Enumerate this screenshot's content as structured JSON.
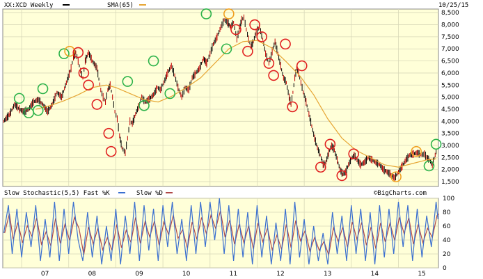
{
  "chart_data": [
    {
      "type": "line",
      "ticker_label": "XX:XCD Weekly",
      "sma_label": "SMA(65)",
      "date_label": "10/25/15",
      "watermark": "©BigCharts.com",
      "y_ticks": [
        "8,500",
        "8,000",
        "7,500",
        "7,000",
        "6,500",
        "6,000",
        "5,500",
        "5,000",
        "4,500",
        "4,000",
        "3,500",
        "3,000",
        "2,500",
        "2,000",
        "1,500"
      ],
      "y_tick_values": [
        8500,
        8000,
        7500,
        7000,
        6500,
        6000,
        5500,
        5000,
        4500,
        4000,
        3500,
        3000,
        2500,
        2000,
        1500
      ],
      "ylim": [
        1300,
        8650
      ],
      "x_tick_labels": [
        "07",
        "08",
        "09",
        "10",
        "11",
        "12",
        "13",
        "14",
        "15"
      ],
      "x_tick_values": [
        2007,
        2008,
        2009,
        2010,
        2011,
        2012,
        2013,
        2014,
        2015
      ],
      "xlim": [
        2006.6,
        2015.85
      ],
      "price_points": [
        [
          2006.62,
          4000
        ],
        [
          2006.75,
          4300
        ],
        [
          2006.85,
          4700
        ],
        [
          2006.95,
          4500
        ],
        [
          2007.05,
          4400
        ],
        [
          2007.15,
          4500
        ],
        [
          2007.25,
          4800
        ],
        [
          2007.35,
          4900
        ],
        [
          2007.45,
          4700
        ],
        [
          2007.55,
          4400
        ],
        [
          2007.65,
          4700
        ],
        [
          2007.75,
          5200
        ],
        [
          2007.85,
          5000
        ],
        [
          2007.95,
          5600
        ],
        [
          2008.05,
          6200
        ],
        [
          2008.1,
          6650
        ],
        [
          2008.15,
          6850
        ],
        [
          2008.2,
          6500
        ],
        [
          2008.25,
          6100
        ],
        [
          2008.3,
          5800
        ],
        [
          2008.35,
          6500
        ],
        [
          2008.42,
          6850
        ],
        [
          2008.5,
          6500
        ],
        [
          2008.6,
          6200
        ],
        [
          2008.68,
          5300
        ],
        [
          2008.73,
          5000
        ],
        [
          2008.78,
          4800
        ],
        [
          2008.83,
          5300
        ],
        [
          2008.88,
          5500
        ],
        [
          2008.93,
          5000
        ],
        [
          2008.98,
          4400
        ],
        [
          2009.03,
          4100
        ],
        [
          2009.08,
          3400
        ],
        [
          2009.13,
          2900
        ],
        [
          2009.2,
          2700
        ],
        [
          2009.25,
          3300
        ],
        [
          2009.3,
          4000
        ],
        [
          2009.35,
          3900
        ],
        [
          2009.42,
          4300
        ],
        [
          2009.48,
          4600
        ],
        [
          2009.55,
          5000
        ],
        [
          2009.62,
          4800
        ],
        [
          2009.7,
          4900
        ],
        [
          2009.8,
          5100
        ],
        [
          2009.88,
          5400
        ],
        [
          2009.95,
          5300
        ],
        [
          2010.02,
          5600
        ],
        [
          2010.1,
          6000
        ],
        [
          2010.18,
          6300
        ],
        [
          2010.25,
          5900
        ],
        [
          2010.32,
          5400
        ],
        [
          2010.4,
          5000
        ],
        [
          2010.47,
          5400
        ],
        [
          2010.55,
          5300
        ],
        [
          2010.62,
          5800
        ],
        [
          2010.7,
          6000
        ],
        [
          2010.78,
          6200
        ],
        [
          2010.86,
          6600
        ],
        [
          2010.93,
          6400
        ],
        [
          2011.0,
          6800
        ],
        [
          2011.07,
          7200
        ],
        [
          2011.15,
          7500
        ],
        [
          2011.23,
          7900
        ],
        [
          2011.3,
          8200
        ],
        [
          2011.37,
          8100
        ],
        [
          2011.44,
          7900
        ],
        [
          2011.5,
          8100
        ],
        [
          2011.57,
          7400
        ],
        [
          2011.62,
          7800
        ],
        [
          2011.67,
          8200
        ],
        [
          2011.72,
          8300
        ],
        [
          2011.77,
          7800
        ],
        [
          2011.82,
          7400
        ],
        [
          2011.87,
          7100
        ],
        [
          2011.92,
          7300
        ],
        [
          2011.98,
          7700
        ],
        [
          2012.05,
          7900
        ],
        [
          2012.12,
          7400
        ],
        [
          2012.18,
          6800
        ],
        [
          2012.25,
          6400
        ],
        [
          2012.32,
          6900
        ],
        [
          2012.38,
          7300
        ],
        [
          2012.44,
          6800
        ],
        [
          2012.5,
          6300
        ],
        [
          2012.56,
          5800
        ],
        [
          2012.62,
          5600
        ],
        [
          2012.68,
          5000
        ],
        [
          2012.72,
          4700
        ],
        [
          2012.76,
          5200
        ],
        [
          2012.8,
          5800
        ],
        [
          2012.84,
          6200
        ],
        [
          2012.88,
          6000
        ],
        [
          2012.93,
          5600
        ],
        [
          2012.98,
          5200
        ],
        [
          2013.04,
          4800
        ],
        [
          2013.1,
          4300
        ],
        [
          2013.16,
          3800
        ],
        [
          2013.22,
          3300
        ],
        [
          2013.28,
          2900
        ],
        [
          2013.34,
          2600
        ],
        [
          2013.4,
          2200
        ],
        [
          2013.46,
          2300
        ],
        [
          2013.52,
          2700
        ],
        [
          2013.58,
          3000
        ],
        [
          2013.64,
          2800
        ],
        [
          2013.7,
          2400
        ],
        [
          2013.76,
          2000
        ],
        [
          2013.82,
          1800
        ],
        [
          2013.88,
          1900
        ],
        [
          2013.94,
          2200
        ],
        [
          2014.0,
          2450
        ],
        [
          2014.06,
          2600
        ],
        [
          2014.12,
          2400
        ],
        [
          2014.2,
          2200
        ],
        [
          2014.28,
          2300
        ],
        [
          2014.36,
          2500
        ],
        [
          2014.44,
          2400
        ],
        [
          2014.52,
          2300
        ],
        [
          2014.6,
          2200
        ],
        [
          2014.68,
          2000
        ],
        [
          2014.76,
          1900
        ],
        [
          2014.84,
          1800
        ],
        [
          2014.92,
          1650
        ],
        [
          2015.0,
          1900
        ],
        [
          2015.08,
          2150
        ],
        [
          2015.16,
          2400
        ],
        [
          2015.24,
          2600
        ],
        [
          2015.32,
          2650
        ],
        [
          2015.4,
          2700
        ],
        [
          2015.48,
          2600
        ],
        [
          2015.55,
          2650
        ],
        [
          2015.6,
          2500
        ],
        [
          2015.66,
          2400
        ],
        [
          2015.72,
          2200
        ],
        [
          2015.78,
          2600
        ],
        [
          2015.82,
          2900
        ]
      ],
      "sma_points": [
        [
          2007.3,
          4500
        ],
        [
          2007.6,
          4650
        ],
        [
          2007.9,
          4850
        ],
        [
          2008.2,
          5100
        ],
        [
          2008.5,
          5400
        ],
        [
          2008.8,
          5500
        ],
        [
          2009.0,
          5400
        ],
        [
          2009.3,
          5150
        ],
        [
          2009.6,
          4900
        ],
        [
          2009.9,
          4800
        ],
        [
          2010.2,
          5050
        ],
        [
          2010.5,
          5400
        ],
        [
          2010.8,
          5800
        ],
        [
          2011.1,
          6400
        ],
        [
          2011.4,
          7000
        ],
        [
          2011.7,
          7300
        ],
        [
          2012.0,
          7350
        ],
        [
          2012.3,
          7050
        ],
        [
          2012.6,
          6500
        ],
        [
          2012.9,
          5900
        ],
        [
          2013.2,
          5100
        ],
        [
          2013.5,
          4100
        ],
        [
          2013.8,
          3300
        ],
        [
          2014.1,
          2800
        ],
        [
          2014.4,
          2500
        ],
        [
          2014.7,
          2200
        ],
        [
          2015.0,
          2100
        ],
        [
          2015.3,
          2250
        ],
        [
          2015.6,
          2400
        ],
        [
          2015.8,
          2450
        ]
      ],
      "sma_color": "#e6a533",
      "price_color": "#000000"
    },
    {
      "type": "line",
      "indicator_label": "Slow Stochastic(5,5) Fast %K",
      "slow_label": "Slow %D",
      "y_ticks": [
        "100",
        "80",
        "60",
        "40",
        "20",
        "0"
      ],
      "y_tick_values": [
        100,
        80,
        60,
        40,
        20,
        0
      ],
      "ylim": [
        0,
        100
      ],
      "fast_color": "#3a6fd0",
      "slow_color": "#b04848",
      "cycles": [
        [
          2006.62,
          50
        ],
        [
          2006.72,
          90
        ],
        [
          2006.8,
          20
        ],
        [
          2006.9,
          85
        ],
        [
          2007.0,
          15
        ],
        [
          2007.1,
          80
        ],
        [
          2007.2,
          30
        ],
        [
          2007.3,
          90
        ],
        [
          2007.4,
          10
        ],
        [
          2007.5,
          70
        ],
        [
          2007.6,
          15
        ],
        [
          2007.7,
          95
        ],
        [
          2007.8,
          10
        ],
        [
          2007.9,
          85
        ],
        [
          2008.0,
          20
        ],
        [
          2008.1,
          95
        ],
        [
          2008.2,
          40
        ],
        [
          2008.3,
          10
        ],
        [
          2008.4,
          80
        ],
        [
          2008.5,
          15
        ],
        [
          2008.6,
          75
        ],
        [
          2008.7,
          5
        ],
        [
          2008.8,
          60
        ],
        [
          2008.9,
          10
        ],
        [
          2009.0,
          85
        ],
        [
          2009.1,
          5
        ],
        [
          2009.2,
          75
        ],
        [
          2009.3,
          20
        ],
        [
          2009.4,
          95
        ],
        [
          2009.5,
          10
        ],
        [
          2009.6,
          90
        ],
        [
          2009.7,
          25
        ],
        [
          2009.8,
          85
        ],
        [
          2009.9,
          10
        ],
        [
          2010.0,
          90
        ],
        [
          2010.1,
          30
        ],
        [
          2010.2,
          95
        ],
        [
          2010.3,
          20
        ],
        [
          2010.4,
          70
        ],
        [
          2010.5,
          10
        ],
        [
          2010.6,
          90
        ],
        [
          2010.7,
          20
        ],
        [
          2010.8,
          95
        ],
        [
          2010.9,
          30
        ],
        [
          2011.0,
          95
        ],
        [
          2011.1,
          40
        ],
        [
          2011.2,
          100
        ],
        [
          2011.3,
          20
        ],
        [
          2011.4,
          90
        ],
        [
          2011.5,
          10
        ],
        [
          2011.6,
          85
        ],
        [
          2011.7,
          15
        ],
        [
          2011.8,
          80
        ],
        [
          2011.9,
          5
        ],
        [
          2012.0,
          90
        ],
        [
          2012.1,
          15
        ],
        [
          2012.2,
          75
        ],
        [
          2012.3,
          5
        ],
        [
          2012.4,
          65
        ],
        [
          2012.5,
          10
        ],
        [
          2012.6,
          85
        ],
        [
          2012.7,
          5
        ],
        [
          2012.8,
          95
        ],
        [
          2012.9,
          15
        ],
        [
          2013.0,
          70
        ],
        [
          2013.1,
          5
        ],
        [
          2013.2,
          60
        ],
        [
          2013.3,
          10
        ],
        [
          2013.4,
          50
        ],
        [
          2013.5,
          5
        ],
        [
          2013.6,
          80
        ],
        [
          2013.7,
          20
        ],
        [
          2013.8,
          75
        ],
        [
          2013.9,
          10
        ],
        [
          2014.0,
          90
        ],
        [
          2014.1,
          20
        ],
        [
          2014.2,
          85
        ],
        [
          2014.3,
          10
        ],
        [
          2014.4,
          80
        ],
        [
          2014.5,
          5
        ],
        [
          2014.6,
          90
        ],
        [
          2014.7,
          15
        ],
        [
          2014.8,
          85
        ],
        [
          2014.9,
          20
        ],
        [
          2015.0,
          95
        ],
        [
          2015.1,
          30
        ],
        [
          2015.2,
          90
        ],
        [
          2015.3,
          10
        ],
        [
          2015.4,
          85
        ],
        [
          2015.5,
          15
        ],
        [
          2015.6,
          75
        ],
        [
          2015.7,
          30
        ],
        [
          2015.8,
          95
        ],
        [
          2015.84,
          70
        ]
      ]
    }
  ],
  "circles": [
    {
      "t": 2006.95,
      "v": 4950,
      "c": "green"
    },
    {
      "t": 2007.15,
      "v": 4350,
      "c": "green"
    },
    {
      "t": 2007.35,
      "v": 4450,
      "c": "green"
    },
    {
      "t": 2007.45,
      "v": 5350,
      "c": "green"
    },
    {
      "t": 2007.9,
      "v": 6800,
      "c": "green"
    },
    {
      "t": 2008.02,
      "v": 6900,
      "c": "orange"
    },
    {
      "t": 2008.2,
      "v": 6850,
      "c": "red"
    },
    {
      "t": 2008.32,
      "v": 6000,
      "c": "red"
    },
    {
      "t": 2008.42,
      "v": 5500,
      "c": "red"
    },
    {
      "t": 2008.6,
      "v": 4700,
      "c": "red"
    },
    {
      "t": 2008.85,
      "v": 3500,
      "c": "red"
    },
    {
      "t": 2008.9,
      "v": 2750,
      "c": "red"
    },
    {
      "t": 2009.25,
      "v": 5650,
      "c": "green"
    },
    {
      "t": 2009.6,
      "v": 4650,
      "c": "green"
    },
    {
      "t": 2009.8,
      "v": 6500,
      "c": "green"
    },
    {
      "t": 2010.15,
      "v": 5150,
      "c": "green"
    },
    {
      "t": 2010.92,
      "v": 8450,
      "c": "green"
    },
    {
      "t": 2011.4,
      "v": 8450,
      "c": "orange"
    },
    {
      "t": 2011.35,
      "v": 7000,
      "c": "green"
    },
    {
      "t": 2011.55,
      "v": 7800,
      "c": "red"
    },
    {
      "t": 2011.8,
      "v": 6900,
      "c": "red"
    },
    {
      "t": 2011.95,
      "v": 8000,
      "c": "red"
    },
    {
      "t": 2012.1,
      "v": 7500,
      "c": "red"
    },
    {
      "t": 2012.25,
      "v": 6400,
      "c": "red"
    },
    {
      "t": 2012.35,
      "v": 5900,
      "c": "red"
    },
    {
      "t": 2012.6,
      "v": 7200,
      "c": "red"
    },
    {
      "t": 2012.75,
      "v": 4600,
      "c": "red"
    },
    {
      "t": 2012.95,
      "v": 6300,
      "c": "red"
    },
    {
      "t": 2013.35,
      "v": 2100,
      "c": "red"
    },
    {
      "t": 2013.55,
      "v": 3050,
      "c": "red"
    },
    {
      "t": 2013.8,
      "v": 1750,
      "c": "red"
    },
    {
      "t": 2014.05,
      "v": 2650,
      "c": "red"
    },
    {
      "t": 2014.95,
      "v": 1700,
      "c": "orange"
    },
    {
      "t": 2015.38,
      "v": 2750,
      "c": "orange"
    },
    {
      "t": 2015.65,
      "v": 2150,
      "c": "green"
    },
    {
      "t": 2015.8,
      "v": 3050,
      "c": "green"
    }
  ],
  "colors": {
    "panel_bg": "#ffffd8",
    "grid": "#d8d8b8",
    "frame": "#888888",
    "green": "#2db34a",
    "red": "#e02020",
    "orange": "#f0a020"
  }
}
